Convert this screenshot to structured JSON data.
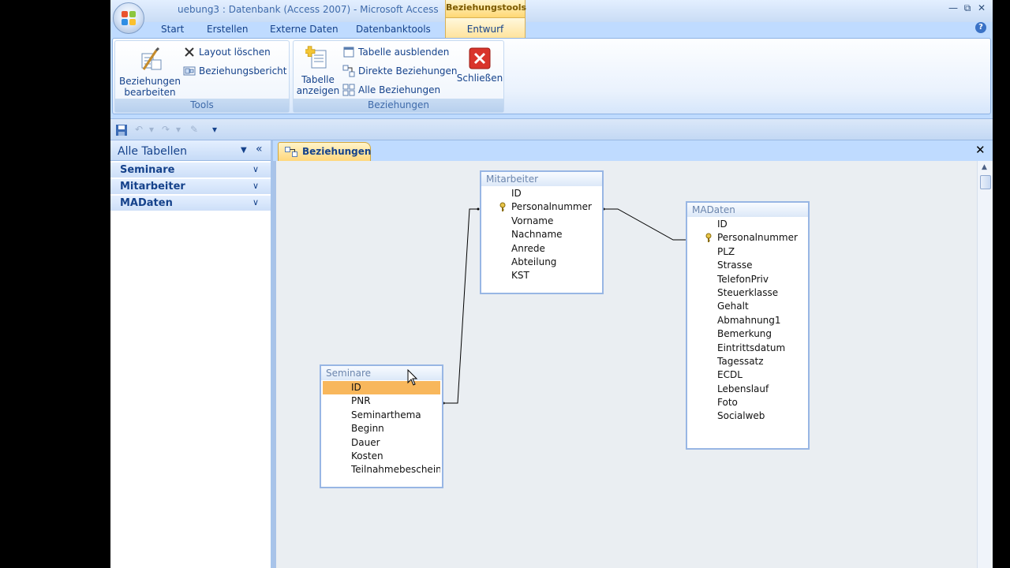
{
  "window": {
    "title": "uebung3 : Datenbank (Access 2007) - Microsoft Access",
    "context_tab": "Beziehungstools",
    "controls": [
      "minimize-icon",
      "restore-icon",
      "close-icon"
    ]
  },
  "ribbon": {
    "tabs": [
      "Start",
      "Erstellen",
      "Externe Daten",
      "Datenbanktools"
    ],
    "active_tab": "Entwurf",
    "groups": {
      "tools": {
        "label": "Tools",
        "edit_line1": "Beziehungen",
        "edit_line2": "bearbeiten",
        "clear_layout": "Layout löschen",
        "report": "Beziehungsbericht"
      },
      "relationships": {
        "label": "Beziehungen",
        "show_table_line1": "Tabelle",
        "show_table_line2": "anzeigen",
        "hide_table": "Tabelle ausblenden",
        "direct_relationships": "Direkte Beziehungen",
        "all_relationships": "Alle Beziehungen",
        "close": "Schließen"
      }
    }
  },
  "nav": {
    "title": "Alle Tabellen",
    "groups": [
      "Seminare",
      "Mitarbeiter",
      "MADaten"
    ]
  },
  "document": {
    "tab_label": "Beziehungen",
    "tables": {
      "mitarbeiter": {
        "name": "Mitarbeiter",
        "fields": [
          "ID",
          "Personalnummer",
          "Vorname",
          "Nachname",
          "Anrede",
          "Abteilung",
          "KST"
        ],
        "key_field": "Personalnummer"
      },
      "madaten": {
        "name": "MADaten",
        "fields": [
          "ID",
          "Personalnummer",
          "PLZ",
          "Strasse",
          "TelefonPriv",
          "Steuerklasse",
          "Gehalt",
          "Abmahnung1",
          "Bemerkung",
          "Eintrittsdatum",
          "Tagessatz",
          "ECDL",
          "Lebenslauf",
          "Foto",
          "Socialweb"
        ],
        "key_field": "Personalnummer"
      },
      "seminare": {
        "name": "Seminare",
        "fields": [
          "ID",
          "PNR",
          "Seminarthema",
          "Beginn",
          "Dauer",
          "Kosten",
          "Teilnahmebescheinig"
        ],
        "selected_field": "ID"
      }
    },
    "relationships": [
      {
        "from": "Mitarbeiter.Personalnummer",
        "to": "MADaten.Personalnummer"
      },
      {
        "from": "Mitarbeiter.Personalnummer",
        "to": "Seminare.PNR"
      }
    ]
  },
  "colors": {
    "ribbon_blue": "#bfdbff",
    "context_tab": "#ffd874",
    "selected_field": "#f8b75c",
    "text_blue": "#15428b"
  }
}
